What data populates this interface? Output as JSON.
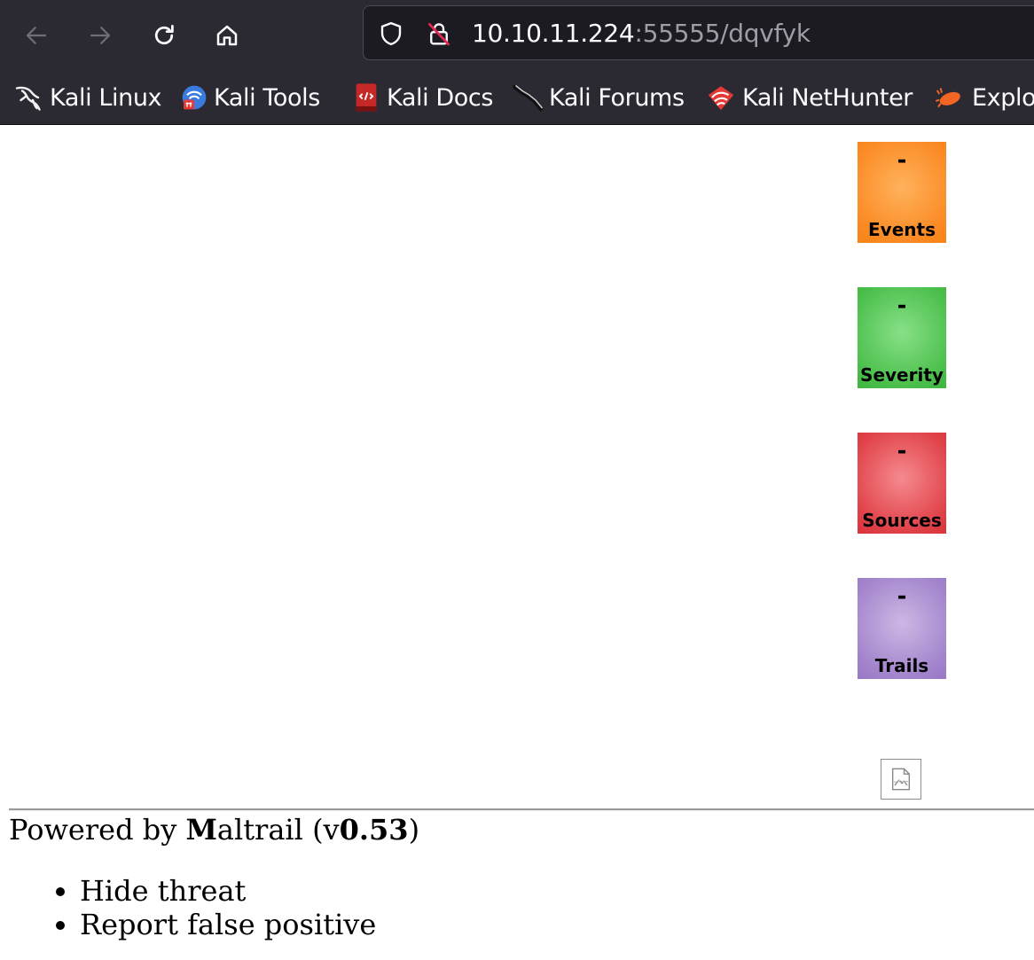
{
  "browser": {
    "url": {
      "host": "10.10.11.224",
      "path": ":55555/dqvfyk"
    },
    "bookmarks": [
      {
        "label": "Kali Linux",
        "icon": "kali-dragon-icon"
      },
      {
        "label": "Kali Tools",
        "icon": "kali-tools-icon"
      },
      {
        "label": "Kali Docs",
        "icon": "kali-docs-icon"
      },
      {
        "label": "Kali Forums",
        "icon": "kali-forums-icon"
      },
      {
        "label": "Kali NetHunter",
        "icon": "kali-nethunter-icon"
      },
      {
        "label": "Explo",
        "icon": "exploit-db-icon"
      }
    ]
  },
  "counters": [
    {
      "label": "Events",
      "value": "-",
      "color": "#fb8a24"
    },
    {
      "label": "Severity",
      "value": "-",
      "color": "#4bbf4b"
    },
    {
      "label": "Sources",
      "value": "-",
      "color": "#e04148"
    },
    {
      "label": "Trails",
      "value": "-",
      "color": "#a284cc"
    }
  ],
  "footer": {
    "prefix": "Powered by ",
    "brand_first": "M",
    "brand_rest": "altrail",
    "version_open": " (v",
    "version": "0.53",
    "version_close": ")"
  },
  "context_menu": {
    "items": [
      "Hide threat",
      "Report false positive"
    ]
  }
}
